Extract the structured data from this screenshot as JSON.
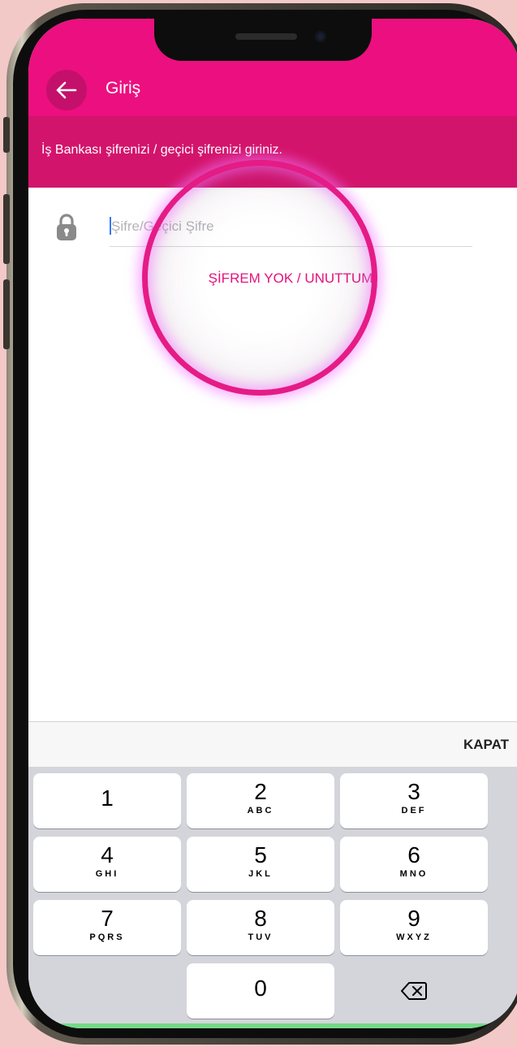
{
  "header": {
    "title": "Giriş",
    "subtitle": "İş Bankası şifrenizi / geçici şifrenizi giriniz."
  },
  "password_field": {
    "placeholder": "Şifre/Geçici Şifre",
    "value": ""
  },
  "forgot_link": "ŞİFREM YOK / UNUTTUM",
  "keyboard": {
    "close_label": "KAPAT",
    "keys": [
      {
        "num": "1",
        "letters": ""
      },
      {
        "num": "2",
        "letters": "ABC"
      },
      {
        "num": "3",
        "letters": "DEF"
      },
      {
        "num": "4",
        "letters": "GHI"
      },
      {
        "num": "5",
        "letters": "JKL"
      },
      {
        "num": "6",
        "letters": "MNO"
      },
      {
        "num": "7",
        "letters": "PQRS"
      },
      {
        "num": "8",
        "letters": "TUV"
      },
      {
        "num": "9",
        "letters": "WXYZ"
      },
      {
        "num": "0",
        "letters": ""
      }
    ]
  },
  "colors": {
    "brand": "#ec0f7f",
    "brand_dark": "#d3146c",
    "link": "#e5127c"
  },
  "icons": {
    "back": "arrow-left-icon",
    "lock": "lock-icon",
    "delete": "backspace-icon"
  }
}
